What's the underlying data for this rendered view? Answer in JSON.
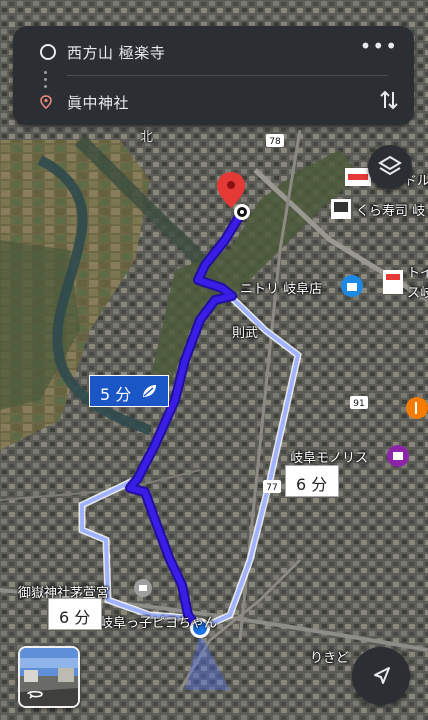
{
  "directions": {
    "origin": "西方山 極楽寺",
    "destination": "眞中神社"
  },
  "map": {
    "labels": {
      "kura": "くら寿司 岐",
      "nitori": "ニトリ 岐阜店",
      "sokubu": "則武",
      "monolith": "岐阜モノリス",
      "shrine": "御嶽神社茅萱宮",
      "piyo": "岐阜っ子ピヨちゃん",
      "rikido": "りきど",
      "do_partial": "ドル",
      "toy_partial": "トイ",
      "su_partial": "ス岐",
      "kita_partial": "北"
    },
    "routes": [
      {
        "label": "5 分",
        "selected": true,
        "mode": "bicycle-icon"
      },
      {
        "label": "6 分",
        "selected": false
      },
      {
        "label": "6 分",
        "selected": false
      }
    ],
    "road_shields": [
      "78",
      "91",
      "77"
    ],
    "colors": {
      "selected_route": "#3a1ee8",
      "alt_route": "#b7c6ff",
      "pin": "#e53935",
      "card": "#2b2e33"
    }
  }
}
